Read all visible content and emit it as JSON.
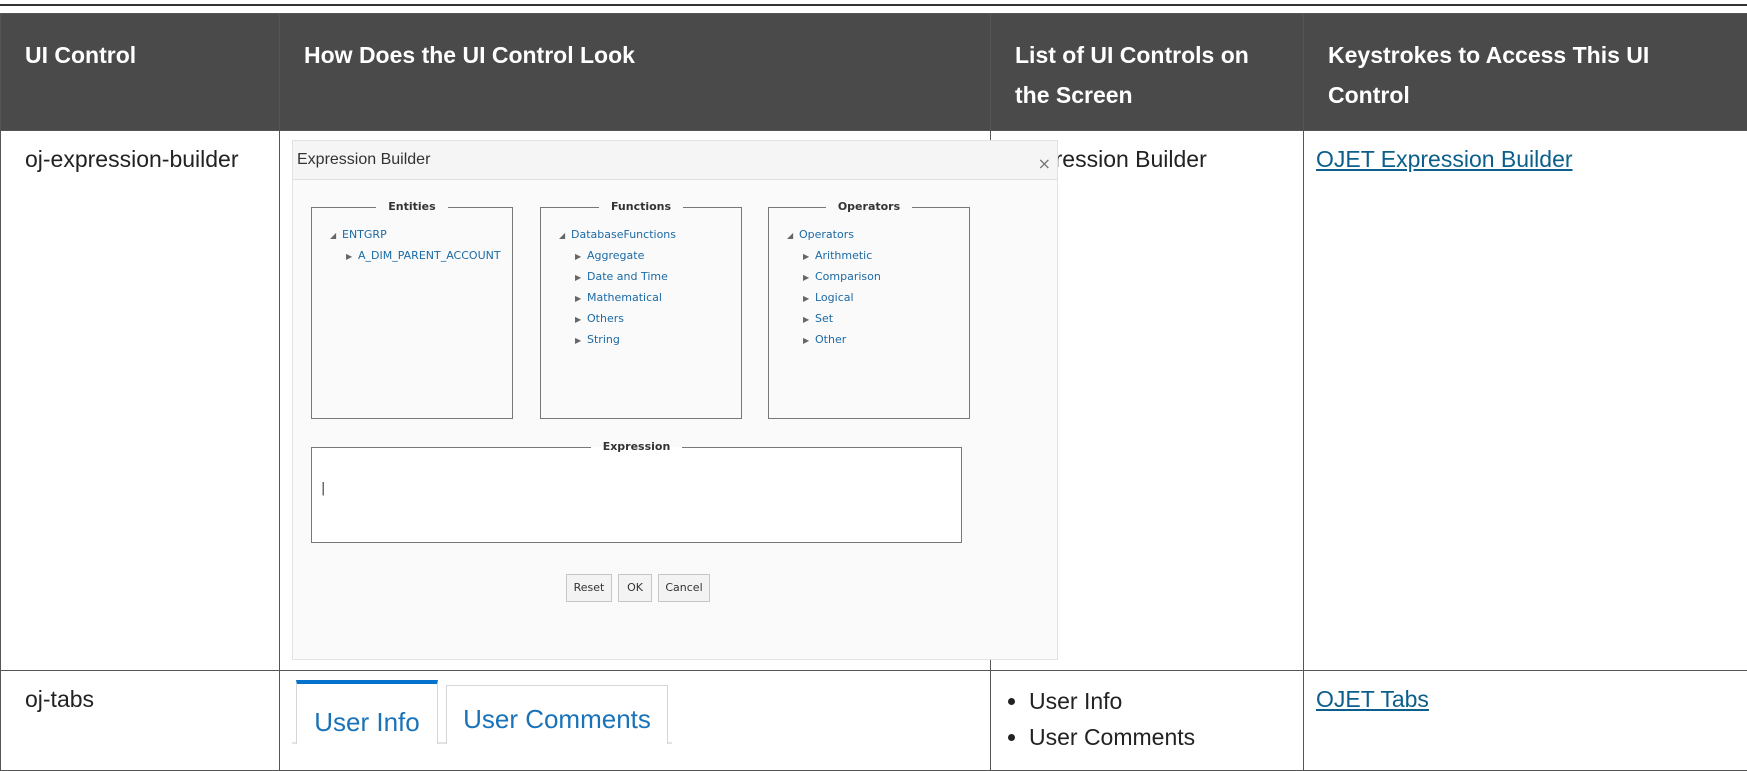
{
  "table": {
    "headers": [
      "UI Control",
      "How Does the UI Control Look",
      "List of UI Controls on the Screen",
      "Keystrokes to Access This UI Control"
    ],
    "rows": [
      {
        "control": "oj-expression-builder",
        "list_item": "Expression Builder",
        "link": "OJET Expression Builder"
      },
      {
        "control": "oj-tabs",
        "list_items": [
          "User Info",
          "User Comments"
        ],
        "link": "OJET Tabs"
      }
    ]
  },
  "expression_builder": {
    "title": "Expression Builder",
    "close": "×",
    "entities": {
      "legend": "Entities",
      "root": "ENTGRP",
      "children": [
        "A_DIM_PARENT_ACCOUNT"
      ]
    },
    "functions": {
      "legend": "Functions",
      "root": "DatabaseFunctions",
      "children": [
        "Aggregate",
        "Date and Time",
        "Mathematical",
        "Others",
        "String"
      ]
    },
    "operators": {
      "legend": "Operators",
      "root": "Operators",
      "children": [
        "Arithmetic",
        "Comparison",
        "Logical",
        "Set",
        "Other"
      ]
    },
    "expression": {
      "legend": "Expression",
      "value": "|"
    },
    "buttons": {
      "reset": "Reset",
      "ok": "OK",
      "cancel": "Cancel"
    }
  },
  "tabs": [
    "User Info",
    "User Comments"
  ],
  "colors": {
    "header_bg": "#4a4a4a",
    "link": "#0b5f8a",
    "tab_accent": "#0572ce",
    "tree_text": "#1b6aa5"
  }
}
